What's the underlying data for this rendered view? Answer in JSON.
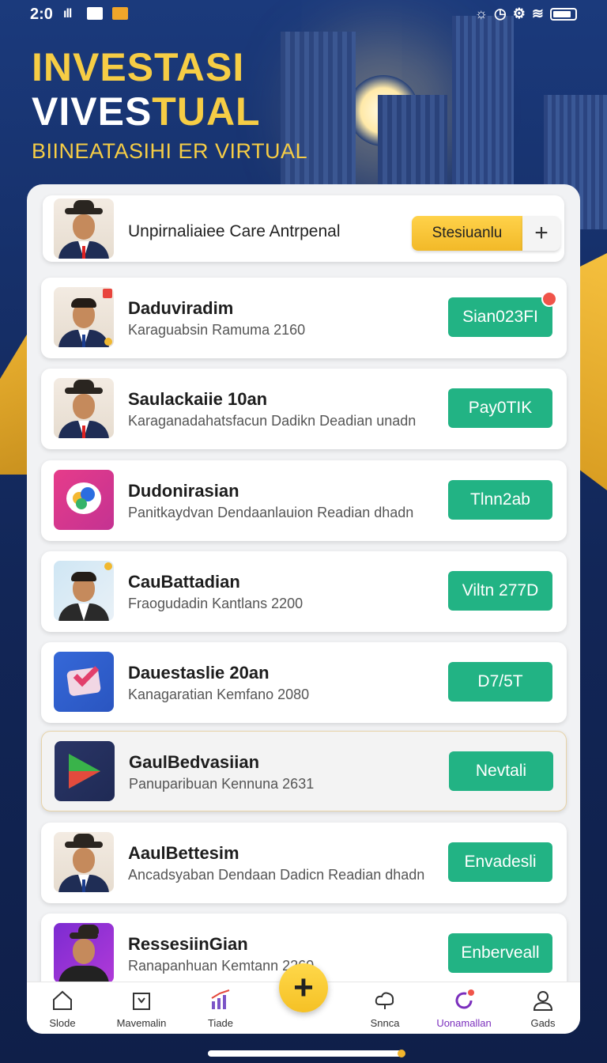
{
  "status_bar": {
    "time": "2:0",
    "signal": "ıll",
    "right_icons": [
      "alarm-icon",
      "clock-icon",
      "settings-icon",
      "signal-icon",
      "wifi-icon",
      "battery-icon"
    ]
  },
  "hero": {
    "line1": "INVESTASI",
    "line2_a": "VIVES",
    "line2_b": "TUAL",
    "subtitle": "BIINEATASIHI ER VIRTUAL"
  },
  "header_card": {
    "title": "Unpirnaliaiee Care Antrpenal",
    "button_label": "Stesiuanlu",
    "plus_label": "+"
  },
  "list": [
    {
      "name": "Daduviradim",
      "sub": "Karaguabsin Ramuma 2160",
      "action": "Sian023FI"
    },
    {
      "name": "Saulackaiie 10an",
      "sub": "Karaganadahatsfacun Dadikn Deadian unadn",
      "action": "Pay0TIK"
    },
    {
      "name": "Dudonirasian",
      "sub": "Panitkaydvan Dendaanlauion Readian dhadn",
      "action": "Tlnn2ab"
    },
    {
      "name": "CauBattadian",
      "sub": "Fraogudadin Kantlans 2200",
      "action": "Viltn 277D"
    },
    {
      "name": "Dauestaslie 20an",
      "sub": "Kanagaratian Kemfano 2080",
      "action": "D7/5T"
    },
    {
      "name": "GaulBedvasiian",
      "sub": "Panuparibuan Kennuna 2631",
      "action": "Nevtali"
    },
    {
      "name": "AaulBettesim",
      "sub": "Ancadsyaban Dendaan Dadicn Readian dhadn",
      "action": "Envadesli"
    },
    {
      "name": "RessesiinGian",
      "sub": "Ranapanhuan Kemtann 2260",
      "action": "Enberveall"
    }
  ],
  "bottom_nav": {
    "items": [
      {
        "label": "Slode",
        "icon": "home-icon"
      },
      {
        "label": "Mavemalin",
        "icon": "bookmark-icon"
      },
      {
        "label": "Tiade",
        "icon": "chart-icon"
      },
      {
        "label": "Snnca",
        "icon": "cloud-icon"
      },
      {
        "label": "Uonamallan",
        "icon": "refresh-icon"
      },
      {
        "label": "Gads",
        "icon": "profile-icon"
      }
    ],
    "fab_label": "+"
  },
  "colors": {
    "accent_gold": "#f6cd45",
    "action_green": "#22b384",
    "nav_active": "#7b2fbd",
    "background_navy": "#13234f"
  }
}
